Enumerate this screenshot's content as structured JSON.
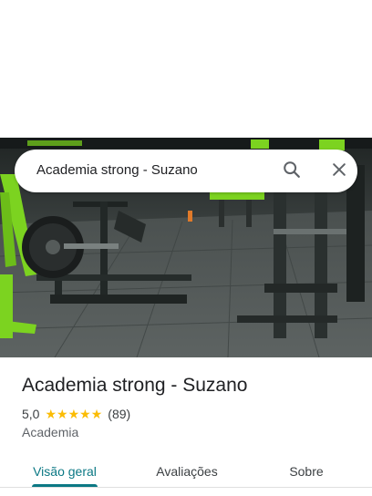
{
  "search": {
    "query": "Academia strong - Suzano",
    "search_icon": "search-icon",
    "close_icon": "close-icon"
  },
  "hero": {
    "image": "gym-interior-photo"
  },
  "place": {
    "title": "Academia strong - Suzano",
    "rating_value": "5,0",
    "stars": 5,
    "rating_count": "(89)",
    "category": "Academia"
  },
  "tabs": [
    {
      "label": "Visão geral",
      "active": true
    },
    {
      "label": "Avaliações",
      "active": false
    },
    {
      "label": "Sobre",
      "active": false
    }
  ],
  "colors": {
    "accent": "#0b7884",
    "star": "#fbbc04",
    "equipment_green": "#7cd320"
  }
}
